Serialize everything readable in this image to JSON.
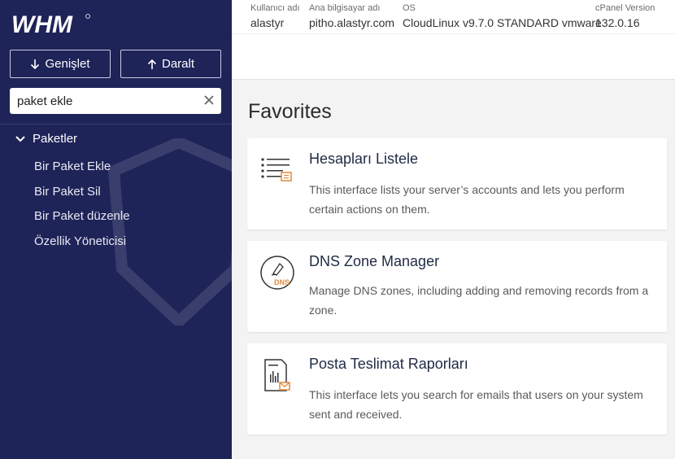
{
  "logo": {
    "text": "WHM"
  },
  "sidebar": {
    "expand_label": "Genişlet",
    "collapse_label": "Daralt",
    "search_value": "paket ekle",
    "category": "Paketler",
    "items": [
      {
        "label": "Bir Paket Ekle"
      },
      {
        "label": "Bir Paket Sil"
      },
      {
        "label": "Bir Paket düzenle"
      },
      {
        "label": "Özellik Yöneticisi"
      }
    ]
  },
  "header": {
    "user_label": "Kullanıcı adı",
    "user_value": "alastyr",
    "host_label": "Ana bilgisayar adı",
    "host_value": "pitho.alastyr.com",
    "os_label": "OS",
    "os_value": "CloudLinux v9.7.0 STANDARD vmware",
    "version_label": "cPanel Version",
    "version_value": "132.0.16"
  },
  "main": {
    "favorites_title": "Favorites",
    "cards": [
      {
        "title": "Hesapları Listele",
        "description": "This interface lists your server’s accounts and lets you perform certain actions on them.",
        "icon": "list-accounts-icon"
      },
      {
        "title": "DNS Zone Manager",
        "description": "Manage DNS zones, including adding and removing records from a zone.",
        "icon": "dns-icon",
        "icon_text": "DNS"
      },
      {
        "title": "Posta Teslimat Raporları",
        "description": "This interface lets you search for emails that users on your system sent and received.",
        "icon": "mail-report-icon"
      }
    ]
  },
  "colors": {
    "sidebar": "#1e2358",
    "accent": "#e08a3c",
    "background": "#f3f3f4"
  }
}
